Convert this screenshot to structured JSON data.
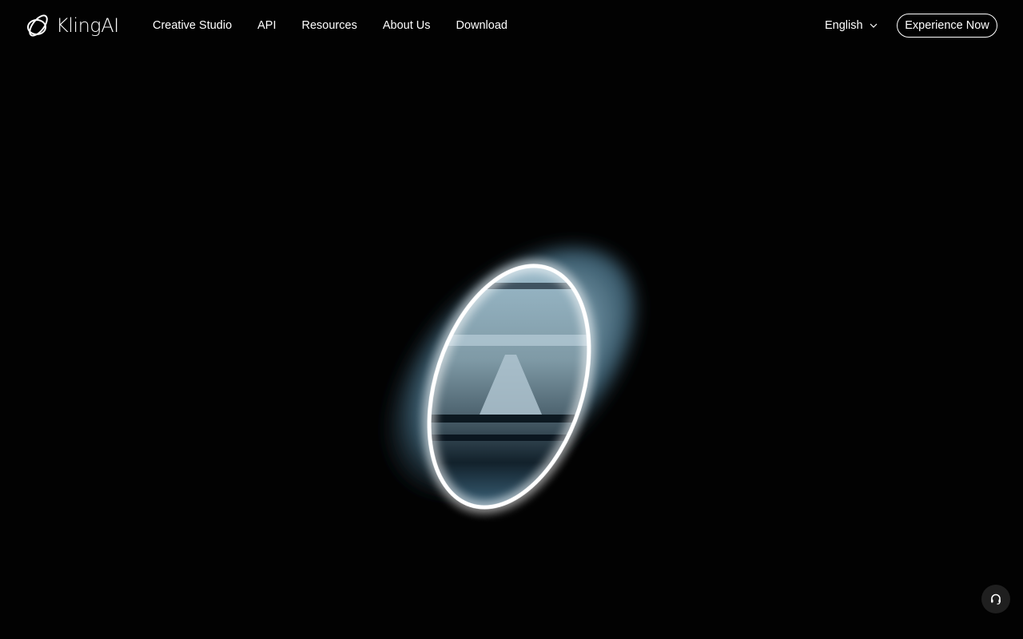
{
  "brand": {
    "name": "KlingAI",
    "logo_icon": "kling-logo-icon"
  },
  "nav": {
    "items": [
      {
        "label": "Creative Studio"
      },
      {
        "label": "API"
      },
      {
        "label": "Resources"
      },
      {
        "label": "About Us"
      },
      {
        "label": "Download"
      }
    ]
  },
  "language": {
    "label": "English",
    "icon": "chevron-down-icon"
  },
  "cta": {
    "label": "Experience Now"
  },
  "hero": {
    "visual": "glowing-ring-portal-video",
    "accent": "#8fb4c6"
  },
  "support": {
    "icon": "headset-icon"
  },
  "colors": {
    "background": "#020202",
    "text": "#ffffff",
    "ring_glow": "#ffffff"
  }
}
